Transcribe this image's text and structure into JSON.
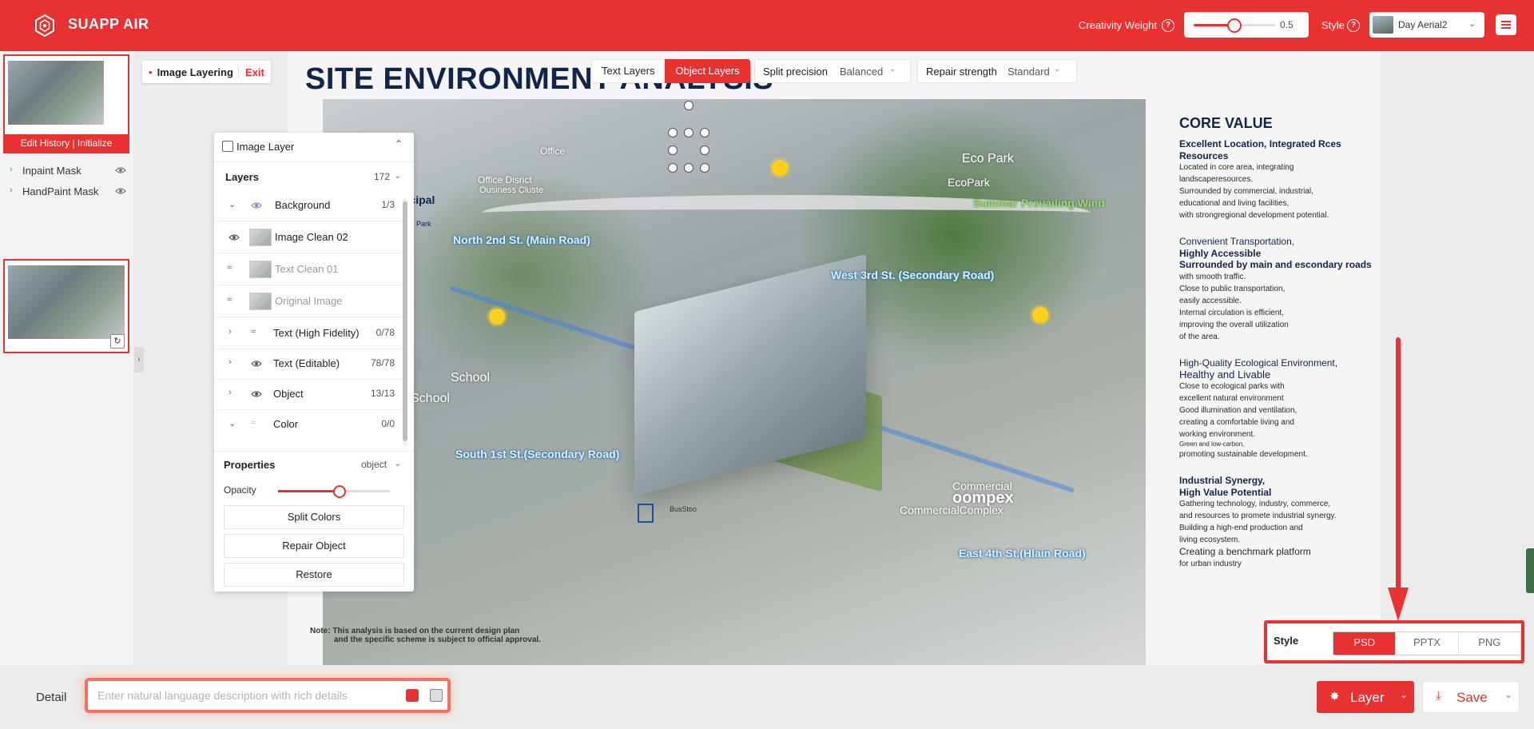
{
  "header": {
    "app_name": "SUAPP AIR",
    "creativity_label": "Creativity Weight",
    "creativity_value": "0.5",
    "creativity_fraction": 0.5,
    "style_label": "Style",
    "style_value": "Day Aerial2",
    "help_glyph": "?"
  },
  "left_panel": {
    "history_button": "Edit History | Initialize",
    "masks": [
      {
        "label": "Inpaint Mask"
      },
      {
        "label": "HandPaint Mask"
      }
    ]
  },
  "toolbar": {
    "image_layering": "Image Layering",
    "exit": "Exit",
    "tabs": [
      "Text Layers",
      "Object Layers"
    ],
    "active_tab": "Object Layers",
    "split_precision_label": "Split precision",
    "split_precision_value": "Balanced",
    "repair_strength_label": "Repair strength",
    "repair_strength_value": "Standard"
  },
  "canvas": {
    "title": "SITE ENVIRONMENT ANALYSIS",
    "map_labels": {
      "north_road": "North 2nd St. (Main Road)",
      "west_road": "West 3rd St. (Secondary Road)",
      "south_road": "South 1st St.(Secondary Road)",
      "east_road": "East 4th St.(Hlain Road)",
      "eco_park": "Eco Park",
      "eco_park_2": "EcoPark",
      "summer_wind": "Summer Prevailing Wind",
      "office": "Office Disrict",
      "office_sub": "Ousiness Cluste",
      "office_top": "Office",
      "municipal": "nicipal",
      "municipal_2": "k",
      "municipal_park": "cipal Park",
      "school": "School",
      "school_2": "School",
      "commercial": "Commercial",
      "complex": "oompex",
      "commercial_complex": "CommercialComplex",
      "bus_stop": "BusStoo"
    },
    "core": {
      "heading": "CORE VALUE",
      "sections": [
        {
          "title": "Excellent Location, Integrated Rces",
          "subtitle": "Resources",
          "lines": [
            "Located in core area, integrating",
            "landscaperesources.",
            "Surrounded by commercial, industrial,",
            "educational and living facilities,",
            "with strongregional development potential."
          ]
        },
        {
          "title": "Convenient Transportation,",
          "subtitle": "Highly Accessible",
          "lines": [
            "Surrounded by main and escondary roads",
            "with smooth traffic.",
            "Close to public transportation,",
            "easily accessible.",
            "Internal circulation is efficient,",
            "improving the overall utilization",
            "of the area."
          ]
        },
        {
          "title": "High-Quality Ecological Environment,",
          "subtitle": "Healthy and Livable",
          "lines": [
            "Close to ecological parks with",
            "excellent natural environment",
            "Good illumination and ventilation,",
            "creating a comfortable living and",
            "working environment.",
            "Green and low-carbon,",
            "promoting sustainable development."
          ]
        },
        {
          "title": "Industrial Synergy,",
          "subtitle": "High Value Potential",
          "lines": [
            "Gathering technology, industry, commerce,",
            "and resources to promete industrial synergy.",
            "Building a high-end production and",
            "living ecosystem.",
            "Creating a benchmark platform",
            "for urban industry"
          ]
        }
      ]
    },
    "note_line1": "Note: This analysis is based on the current design plan",
    "note_line2": "and the specific scheme is subject to official approval."
  },
  "layer_panel": {
    "title": "Image Layer",
    "layers_heading": "Layers",
    "layers_count": "172",
    "rows": [
      {
        "label": "Background",
        "count": "1/3"
      },
      {
        "label": "Image Clean 02",
        "count": ""
      },
      {
        "label": "Text Clean 01",
        "count": ""
      },
      {
        "label": "Original Image",
        "count": ""
      },
      {
        "label": "Text (High Fidelity)",
        "count": "0/78"
      },
      {
        "label": "Text (Editable)",
        "count": "78/78"
      },
      {
        "label": "Object",
        "count": "13/13"
      },
      {
        "label": "Color",
        "count": "0/0"
      }
    ],
    "properties_heading": "Properties",
    "properties_value": "object",
    "opacity_label": "Opacity",
    "opacity_fraction": 0.55,
    "buttons": [
      "Split Colors",
      "Repair Object",
      "Restore"
    ]
  },
  "export": {
    "label": "Style",
    "options": [
      "PSD",
      "PPTX",
      "PNG"
    ],
    "selected": "PSD"
  },
  "bottom": {
    "detail_label": "Detail",
    "detail_placeholder": "Enter natural language description with rich details",
    "layer_button": "Layer",
    "save_button": "Save"
  },
  "colors": {
    "brand": "#e83131",
    "title_navy": "#13244a"
  }
}
